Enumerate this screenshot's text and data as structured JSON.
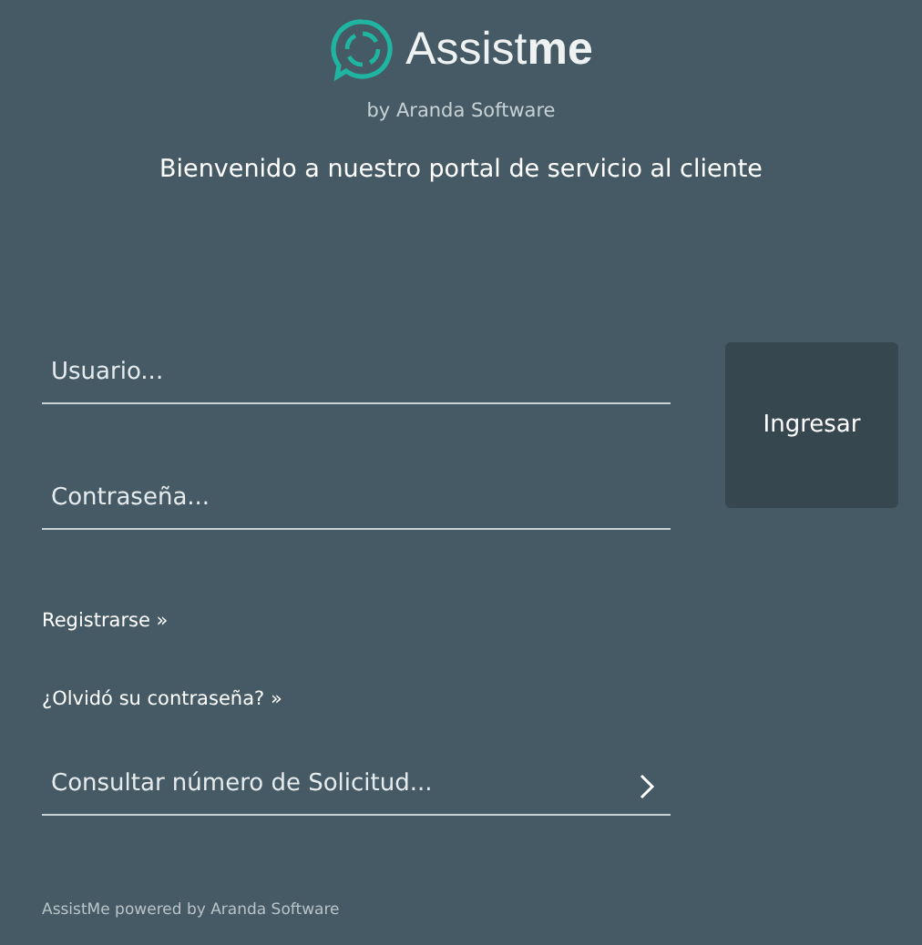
{
  "logo": {
    "name": "Assist**me**",
    "byline": "by Aranda Software"
  },
  "welcome": "Bienvenido a nuestro portal de servicio al cliente",
  "login": {
    "username": {
      "placeholder": "Usuario..."
    },
    "password": {
      "placeholder": "Contraseña..."
    },
    "submit": "Ingresar"
  },
  "links": [
    {
      "label": "Registrarse",
      "arrow": "»"
    },
    {
      "label": "¿Olvidó su contraseña?",
      "arrow": "»"
    }
  ],
  "request_lookup": {
    "placeholder": "Consultar número de Solicitud..."
  },
  "footer": "AssistMe powered by Aranda Software"
}
